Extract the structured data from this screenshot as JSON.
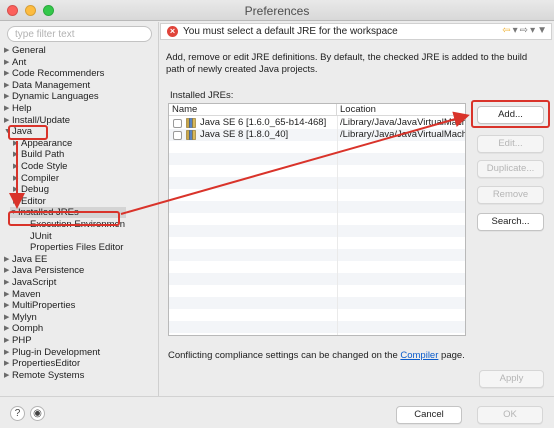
{
  "window": {
    "title": "Preferences"
  },
  "filter": {
    "placeholder": "type filter text"
  },
  "tree": [
    {
      "label": "General",
      "twisty": "▶"
    },
    {
      "label": "Ant",
      "twisty": "▶"
    },
    {
      "label": "Code Recommenders",
      "twisty": "▶"
    },
    {
      "label": "Data Management",
      "twisty": "▶"
    },
    {
      "label": "Dynamic Languages",
      "twisty": "▶"
    },
    {
      "label": "Help",
      "twisty": "▶"
    },
    {
      "label": "Install/Update",
      "twisty": "▶"
    },
    {
      "label": "Java",
      "twisty": "▼"
    },
    {
      "label": "Appearance",
      "twisty": "▶"
    },
    {
      "label": "Build Path",
      "twisty": "▶"
    },
    {
      "label": "Code Style",
      "twisty": "▶"
    },
    {
      "label": "Compiler",
      "twisty": "▶"
    },
    {
      "label": "Debug",
      "twisty": "▶"
    },
    {
      "label": "Editor",
      "twisty": "▶"
    },
    {
      "label": "Installed JREs",
      "twisty": "▼"
    },
    {
      "label": "Execution Environmen",
      "twisty": ""
    },
    {
      "label": "JUnit",
      "twisty": ""
    },
    {
      "label": "Properties Files Editor",
      "twisty": ""
    },
    {
      "label": "Java EE",
      "twisty": "▶"
    },
    {
      "label": "Java Persistence",
      "twisty": "▶"
    },
    {
      "label": "JavaScript",
      "twisty": "▶"
    },
    {
      "label": "Maven",
      "twisty": "▶"
    },
    {
      "label": "MultiProperties",
      "twisty": "▶"
    },
    {
      "label": "Mylyn",
      "twisty": "▶"
    },
    {
      "label": "Oomph",
      "twisty": "▶"
    },
    {
      "label": "PHP",
      "twisty": "▶"
    },
    {
      "label": "Plug-in Development",
      "twisty": "▶"
    },
    {
      "label": "PropertiesEditor",
      "twisty": "▶"
    },
    {
      "label": "Remote Systems",
      "twisty": "▶"
    }
  ],
  "error": {
    "icon": "×",
    "message": "You must select a default JRE for the workspace"
  },
  "nav": {
    "back": "⇦",
    "back_menu": "▾",
    "forward": "⇨",
    "forward_menu": "▾",
    "view_menu": "▼"
  },
  "description": "Add, remove or edit JRE definitions. By default, the checked JRE is added to the build path of newly created Java projects.",
  "installed_label": "Installed JREs:",
  "table": {
    "headers": [
      "Name",
      "Location"
    ],
    "rows": [
      {
        "name": "Java SE 6 [1.6.0_65-b14-468]",
        "location": "/Library/Java/JavaVirtualMachines"
      },
      {
        "name": "Java SE 8 [1.8.0_40]",
        "location": "/Library/Java/JavaVirtualMachines"
      }
    ]
  },
  "buttons": {
    "add": "Add...",
    "edit": "Edit...",
    "duplicate": "Duplicate...",
    "remove": "Remove",
    "search": "Search...",
    "apply": "Apply",
    "cancel": "Cancel",
    "ok": "OK"
  },
  "compliance": {
    "prefix": "Conflicting compliance settings can be changed on the ",
    "link": "Compiler",
    "suffix": " page."
  },
  "bottom": {
    "help_icon": "?",
    "import_icon": "◉"
  },
  "colors": {
    "annotation": "#d9332a",
    "error": "#e0443a",
    "link": "#0b5ccc"
  }
}
